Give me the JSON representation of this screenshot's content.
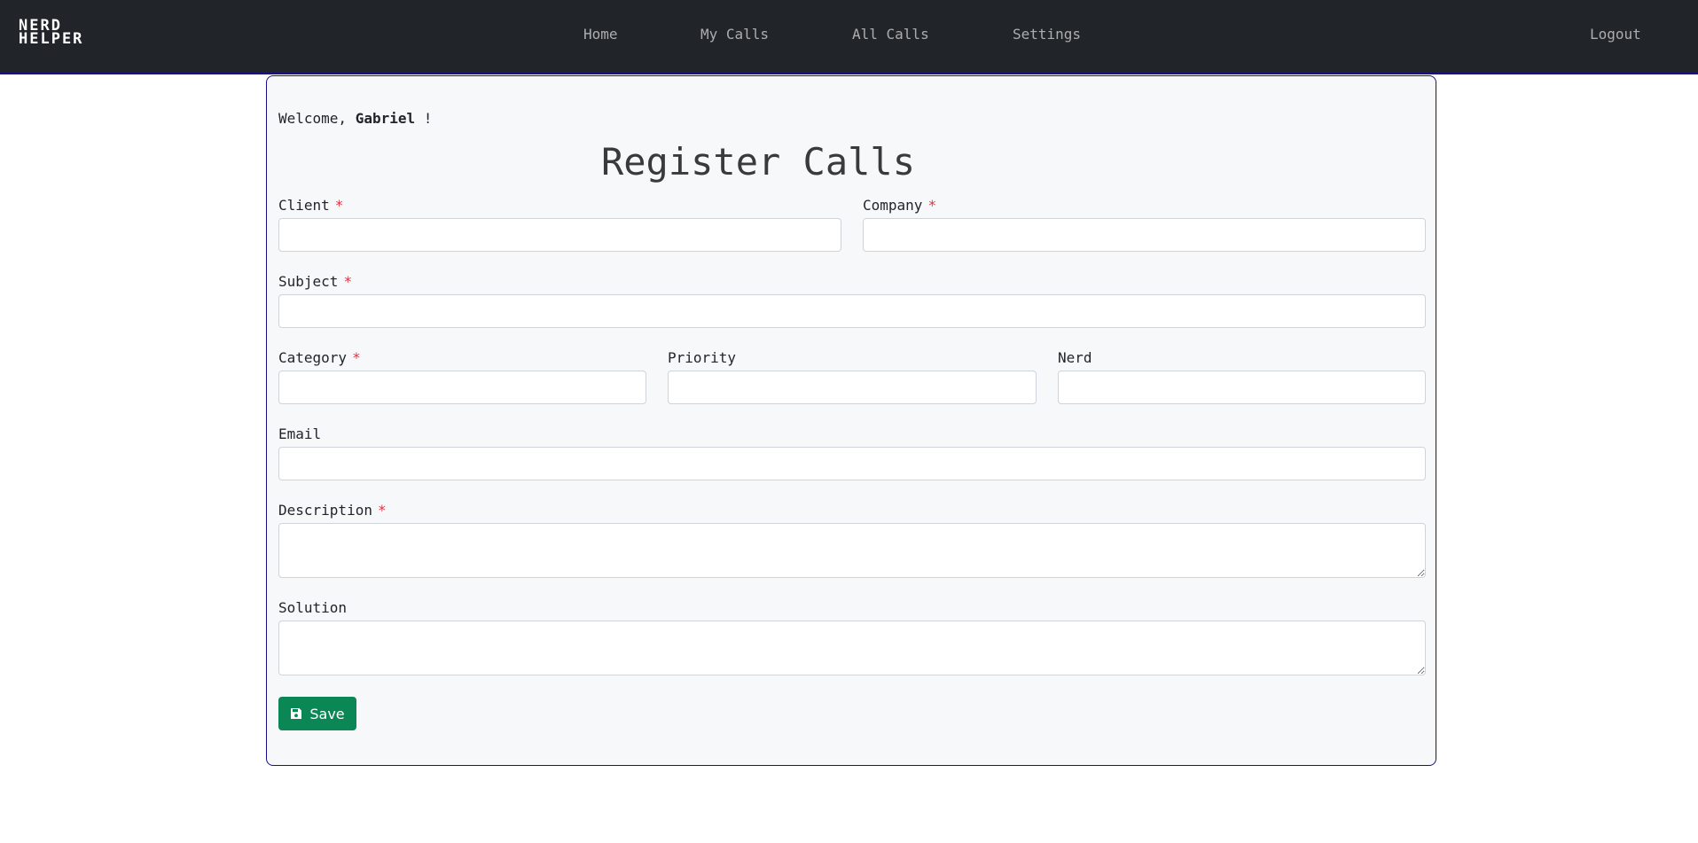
{
  "brand": {
    "line1": "NERD",
    "line2": "HELPER"
  },
  "nav": {
    "home": "Home",
    "my_calls": "My Calls",
    "all_calls": "All Calls",
    "settings": "Settings",
    "logout": "Logout"
  },
  "welcome": {
    "prefix": "Welcome, ",
    "name": "Gabriel",
    "suffix": " !"
  },
  "page_title": "Register Calls",
  "form": {
    "client": {
      "label": "Client",
      "required": "*",
      "value": "",
      "placeholder": ""
    },
    "company": {
      "label": "Company",
      "required": "*",
      "value": "",
      "placeholder": ""
    },
    "subject": {
      "label": "Subject",
      "required": "*",
      "value": "",
      "placeholder": ""
    },
    "category": {
      "label": "Category",
      "required": "*",
      "value": "",
      "placeholder": ""
    },
    "priority": {
      "label": "Priority",
      "value": "",
      "placeholder": ""
    },
    "nerd": {
      "label": "Nerd",
      "value": "",
      "placeholder": ""
    },
    "email": {
      "label": "Email",
      "value": "",
      "placeholder": ""
    },
    "description": {
      "label": "Description",
      "required": "*",
      "value": "",
      "placeholder": ""
    },
    "solution": {
      "label": "Solution",
      "value": "",
      "placeholder": ""
    },
    "save_label": "Save",
    "save_icon": "floppy-disk-icon"
  },
  "colors": {
    "navbar_bg": "#212529",
    "accent_border": "#1a0f8a",
    "required": "#dc3545",
    "save_button": "#0a8754"
  }
}
